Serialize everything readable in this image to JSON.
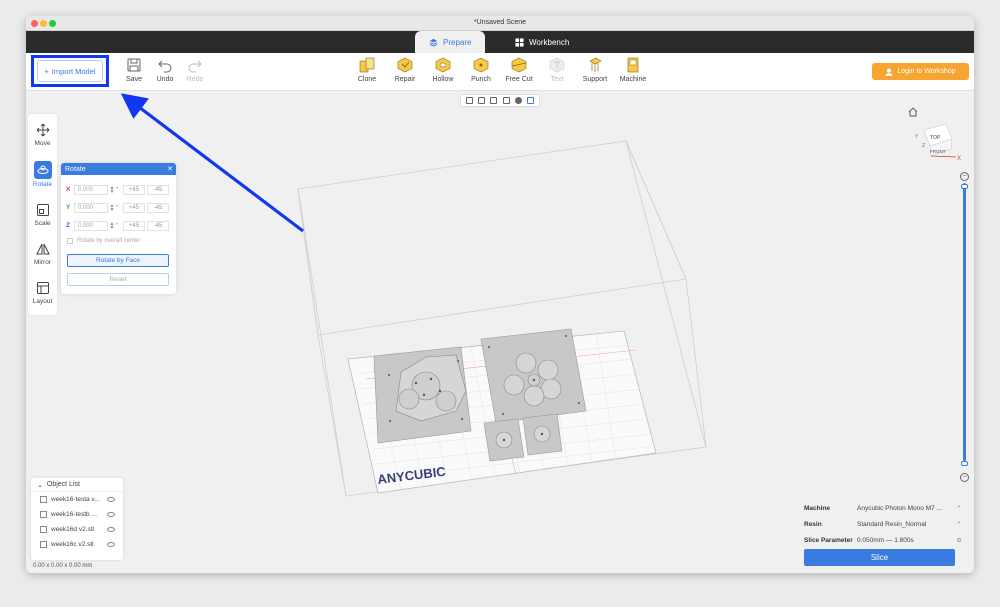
{
  "window": {
    "title": "*Unsaved Scene"
  },
  "tabs": [
    {
      "label": "Prepare",
      "active": true
    },
    {
      "label": "Workbench",
      "active": false
    }
  ],
  "toolbar": {
    "import_label": "Import Model",
    "save_label": "Save",
    "undo_label": "Undo",
    "redo_label": "Redo",
    "tools": [
      "Clone",
      "Repair",
      "Hollow",
      "Punch",
      "Free Cut",
      "Text",
      "Support",
      "Machine"
    ],
    "login_label": "Login to Workshop"
  },
  "left_tools": [
    "Move",
    "Rotate",
    "Scale",
    "Mirror",
    "Layout"
  ],
  "rotate_panel": {
    "title": "Rotate",
    "axes": [
      {
        "axis": "X",
        "value": "0.000",
        "plus": "+45",
        "minus": "-45",
        "color": "#e03a3a"
      },
      {
        "axis": "Y",
        "value": "0.000",
        "plus": "+45",
        "minus": "-45",
        "color": "#3aa83a"
      },
      {
        "axis": "Z",
        "value": "0.000",
        "plus": "+45",
        "minus": "-45",
        "color": "#3a5be0"
      }
    ],
    "degree_symbol": "°",
    "checkbox_label": "Rotate by overall center",
    "face_button": "Rotate by Face",
    "reset_button": "Reset"
  },
  "cube_nav": {
    "top": "TOP",
    "front": "FRONT",
    "x": "X",
    "y": "Y",
    "z": "Z"
  },
  "brand": {
    "text": "ANYCUBIC"
  },
  "object_list": {
    "title": "Object List",
    "items": [
      "week16-testa v...",
      "week16-testb ...",
      "week16d v2.stl",
      "week16c v2.stl"
    ]
  },
  "dimensions": "0.00 x 0.00 x 0.00 mm",
  "slice_panel": {
    "machine_label": "Machine",
    "machine_value": "Anycubic Photon Mono M7 ...",
    "resin_label": "Resin",
    "resin_value": "Standard Resin_Normal",
    "param_label": "Slice Parameter",
    "param_value": "0.050mm — 1.800s",
    "slice_button": "Slice"
  },
  "colors": {
    "accent": "#3a7be0",
    "login": "#f7a530",
    "annotation": "#1138ef"
  }
}
